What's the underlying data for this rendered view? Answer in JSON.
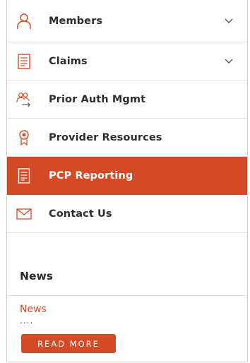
{
  "nav": {
    "items": [
      {
        "label": "Members",
        "icon": "person-icon",
        "expandable": true
      },
      {
        "label": "Claims",
        "icon": "document-icon",
        "expandable": true
      },
      {
        "label": "Prior Auth Mgmt",
        "icon": "people-transfer-icon",
        "expandable": false
      },
      {
        "label": "Provider Resources",
        "icon": "badge-icon",
        "expandable": false
      },
      {
        "label": "PCP Reporting",
        "icon": "report-icon",
        "expandable": false,
        "active": true
      },
      {
        "label": "Contact Us",
        "icon": "envelope-icon",
        "expandable": false
      }
    ]
  },
  "news": {
    "heading": "News",
    "link_text": "News",
    "ellipsis": "....",
    "read_more_label": "READ MORE"
  },
  "colors": {
    "accent": "#d24b26",
    "text": "#2e2e2e",
    "divider": "#e1e1e1"
  }
}
